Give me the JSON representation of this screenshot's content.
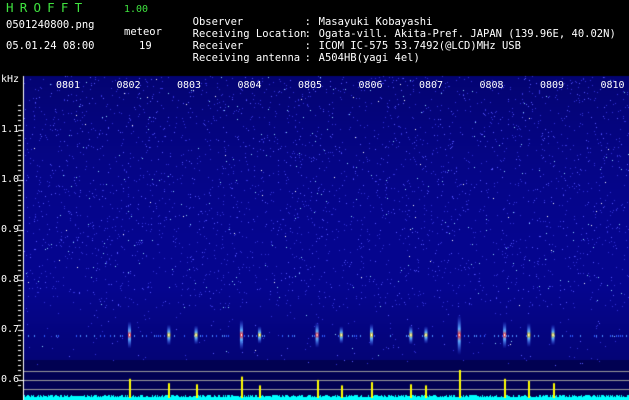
{
  "header": {
    "app_title": "HROFFT",
    "version": "1.00",
    "filename": "0501240800.png",
    "meteor_label": "meteor",
    "datetime": "05.01.24 08:00",
    "meteor_count": "19"
  },
  "info": [
    {
      "key": "Observer",
      "value": "Masayuki Kobayashi"
    },
    {
      "key": "Receiving Location",
      "value": "Ogata-vill. Akita-Pref. JAPAN (139.96E, 40.02N)"
    },
    {
      "key": "Receiver",
      "value": "ICOM IC-575 53.7492(@LCD)MHz USB"
    },
    {
      "key": "Receiving antenna",
      "value": "A504HB(yagi 4el)"
    }
  ],
  "axis": {
    "unit": "kHz",
    "freq_labels": [
      "1.1",
      "1.0",
      "0.9",
      "0.8",
      "0.7",
      "0.6"
    ],
    "freq_values": [
      1.1,
      1.0,
      0.9,
      0.8,
      0.7,
      0.6
    ],
    "time_labels": [
      "0801",
      "0802",
      "0803",
      "0804",
      "0805",
      "0806",
      "0807",
      "0808",
      "0809",
      "0810"
    ]
  },
  "chart_data": {
    "type": "heatmap",
    "y_unit": "kHz",
    "ylim": [
      0.58,
      1.2
    ],
    "x_categories": [
      "0801",
      "0802",
      "0803",
      "0804",
      "0805",
      "0806",
      "0807",
      "0808",
      "0809",
      "0810"
    ],
    "carrier_khz": 0.69,
    "meteor_echoes": [
      {
        "minute": 2.55,
        "strength": 0.6
      },
      {
        "minute": 3.2,
        "strength": 0.4
      },
      {
        "minute": 3.65,
        "strength": 0.35
      },
      {
        "minute": 4.4,
        "strength": 0.7
      },
      {
        "minute": 4.7,
        "strength": 0.3
      },
      {
        "minute": 5.65,
        "strength": 0.55
      },
      {
        "minute": 6.05,
        "strength": 0.3
      },
      {
        "minute": 6.55,
        "strength": 0.45
      },
      {
        "minute": 7.2,
        "strength": 0.35
      },
      {
        "minute": 7.45,
        "strength": 0.3
      },
      {
        "minute": 8.0,
        "strength": 1.0
      },
      {
        "minute": 8.75,
        "strength": 0.6
      },
      {
        "minute": 9.15,
        "strength": 0.5
      },
      {
        "minute": 9.55,
        "strength": 0.4
      }
    ],
    "colors": {
      "background_dark": "#06065a",
      "background_light": "#2a2ac8",
      "signal_peak": "#ffffff",
      "signal_mid": "#ffd700",
      "signal_strong": "#ff3030",
      "header_green": "#3fe23f",
      "amplitude_trace": "#00ffff",
      "amplitude_spike": "#ffff00"
    }
  }
}
